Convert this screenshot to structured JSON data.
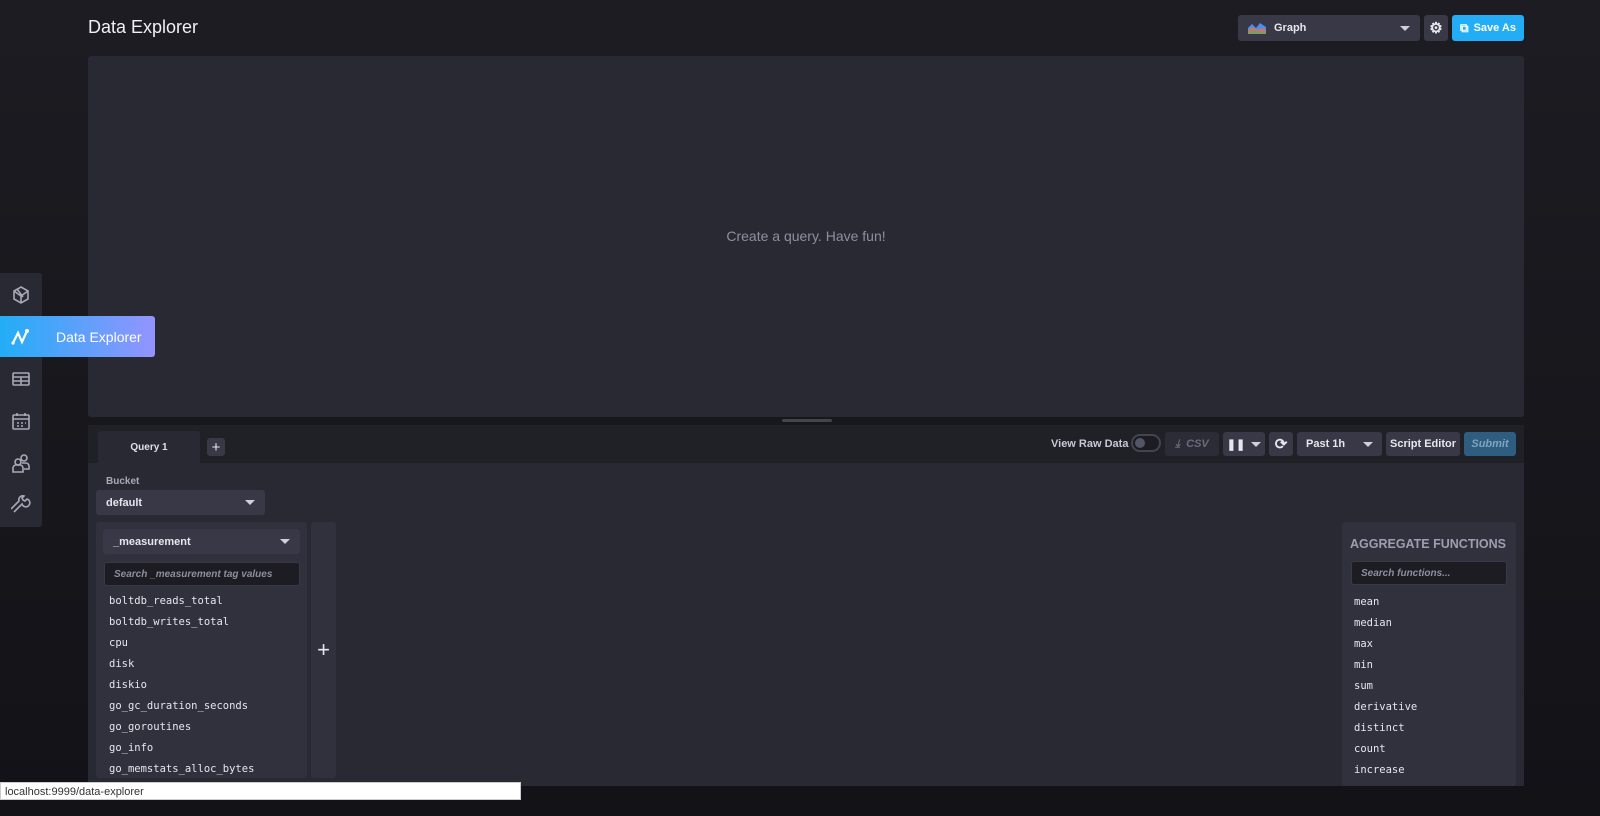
{
  "header": {
    "title": "Data Explorer",
    "view_type": "Graph",
    "save_as": "Save As"
  },
  "graph": {
    "empty_message": "Create a query. Have fun!"
  },
  "query_bar": {
    "tab": "Query 1",
    "view_raw_data": "View Raw Data",
    "raw_data_on": false,
    "csv": "CSV",
    "time_range": "Past 1h",
    "script_editor": "Script Editor",
    "submit": "Submit"
  },
  "builder": {
    "bucket_label": "Bucket",
    "bucket": "default",
    "tag_key": "_measurement",
    "tag_search_placeholder": "Search _measurement tag values",
    "tag_values": [
      "boltdb_reads_total",
      "boltdb_writes_total",
      "cpu",
      "disk",
      "diskio",
      "go_gc_duration_seconds",
      "go_goroutines",
      "go_info",
      "go_memstats_alloc_bytes"
    ]
  },
  "aggregate": {
    "title": "AGGREGATE FUNCTIONS",
    "search_placeholder": "Search functions...",
    "functions": [
      "mean",
      "median",
      "max",
      "min",
      "sum",
      "derivative",
      "distinct",
      "count",
      "increase"
    ]
  },
  "nav": {
    "active_label": "Data Explorer",
    "items": [
      "getting-started",
      "data-explorer",
      "dashboards",
      "tasks",
      "organizations",
      "settings"
    ]
  },
  "status_bar": {
    "url": "localhost:9999/data-explorer"
  },
  "colors": {
    "accent": "#22adf6",
    "accent_end": "#9394ff",
    "panel": "#292933"
  }
}
